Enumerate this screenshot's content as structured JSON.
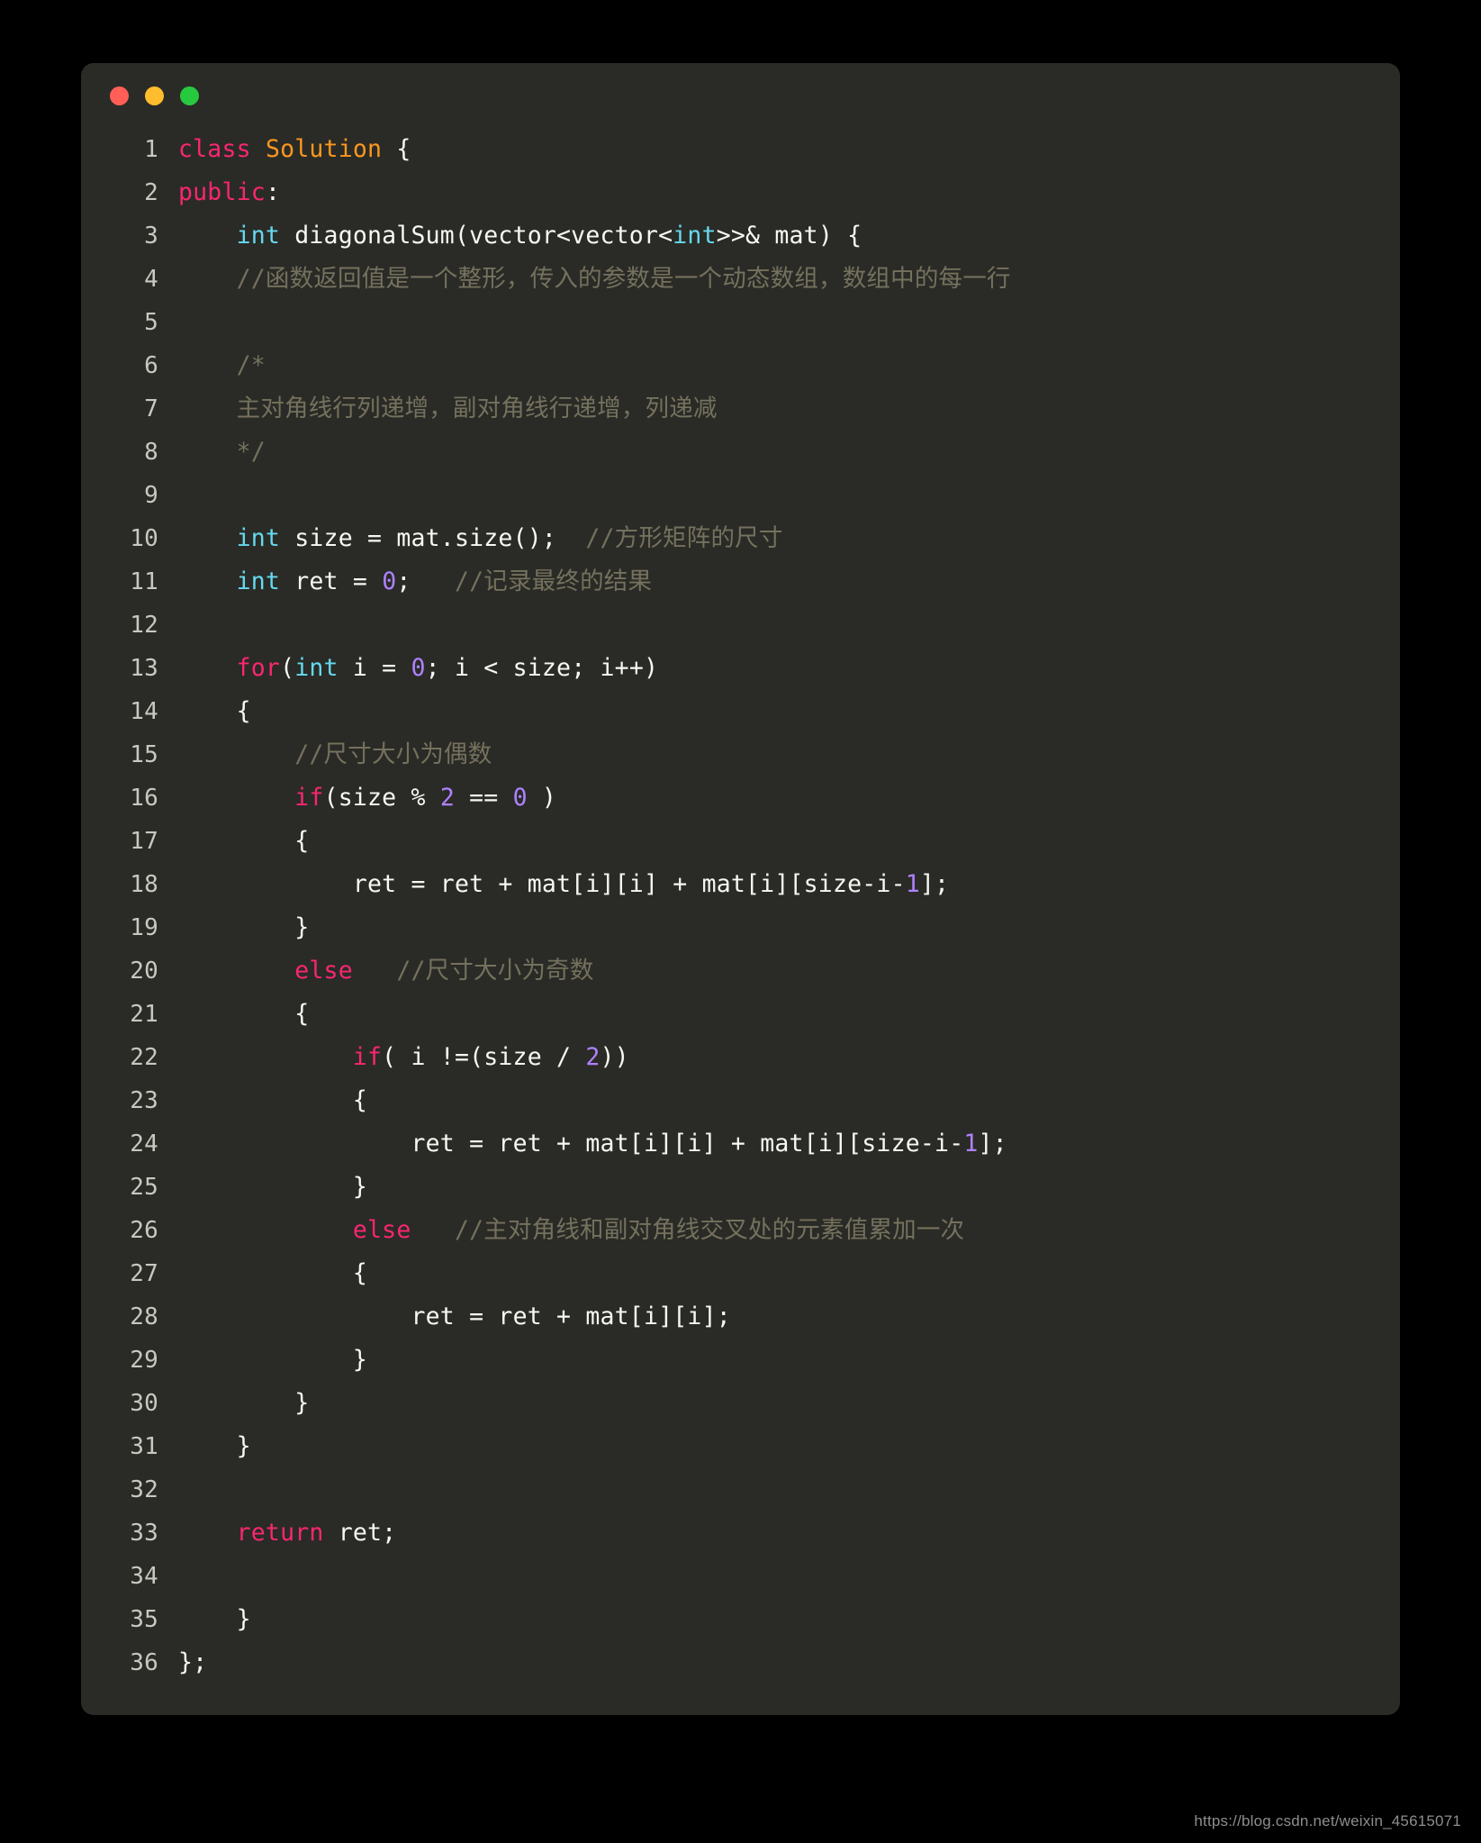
{
  "window": {
    "controls": [
      {
        "name": "close",
        "color": "#ff5f56"
      },
      {
        "name": "minimize",
        "color": "#ffbd2e"
      },
      {
        "name": "maximize",
        "color": "#27c93f"
      }
    ]
  },
  "theme": {
    "background": "#000000",
    "window_background": "#2a2b26",
    "keyword": "#f92672",
    "type": "#66d9ef",
    "class_name": "#fd971f",
    "number": "#ae81ff",
    "comment": "#75715e",
    "plain": "#f8f8f2",
    "line_number": "#c8c8c0"
  },
  "language": "C++",
  "code": {
    "lines": [
      {
        "n": "1",
        "tokens": [
          {
            "t": "class",
            "c": "kw"
          },
          {
            "t": " ",
            "c": "pun"
          },
          {
            "t": "Solution",
            "c": "cls"
          },
          {
            "t": " {",
            "c": "pun"
          }
        ]
      },
      {
        "n": "2",
        "tokens": [
          {
            "t": "public",
            "c": "kw"
          },
          {
            "t": ":",
            "c": "pun"
          }
        ]
      },
      {
        "n": "3",
        "tokens": [
          {
            "t": "    ",
            "c": "pun"
          },
          {
            "t": "int",
            "c": "typ"
          },
          {
            "t": " diagonalSum(vector<vector<",
            "c": "pun"
          },
          {
            "t": "int",
            "c": "typ"
          },
          {
            "t": ">>& mat) {",
            "c": "pun"
          }
        ]
      },
      {
        "n": "4",
        "tokens": [
          {
            "t": "    //函数返回值是一个整形，传入的参数是一个动态数组，数组中的每一行",
            "c": "cmt"
          }
        ]
      },
      {
        "n": "5",
        "tokens": [
          {
            "t": "",
            "c": "pun"
          }
        ]
      },
      {
        "n": "6",
        "tokens": [
          {
            "t": "    /*",
            "c": "cmt"
          }
        ]
      },
      {
        "n": "7",
        "tokens": [
          {
            "t": "    主对角线行列递增，副对角线行递增，列递减",
            "c": "cmt"
          }
        ]
      },
      {
        "n": "8",
        "tokens": [
          {
            "t": "    */",
            "c": "cmt"
          }
        ]
      },
      {
        "n": "9",
        "tokens": [
          {
            "t": "",
            "c": "pun"
          }
        ]
      },
      {
        "n": "10",
        "tokens": [
          {
            "t": "    ",
            "c": "pun"
          },
          {
            "t": "int",
            "c": "typ"
          },
          {
            "t": " size = mat.size();  ",
            "c": "pun"
          },
          {
            "t": "//方形矩阵的尺寸",
            "c": "cmt"
          }
        ]
      },
      {
        "n": "11",
        "tokens": [
          {
            "t": "    ",
            "c": "pun"
          },
          {
            "t": "int",
            "c": "typ"
          },
          {
            "t": " ret = ",
            "c": "pun"
          },
          {
            "t": "0",
            "c": "num"
          },
          {
            "t": ";   ",
            "c": "pun"
          },
          {
            "t": "//记录最终的结果",
            "c": "cmt"
          }
        ]
      },
      {
        "n": "12",
        "tokens": [
          {
            "t": "",
            "c": "pun"
          }
        ]
      },
      {
        "n": "13",
        "tokens": [
          {
            "t": "    ",
            "c": "pun"
          },
          {
            "t": "for",
            "c": "kw"
          },
          {
            "t": "(",
            "c": "pun"
          },
          {
            "t": "int",
            "c": "typ"
          },
          {
            "t": " i = ",
            "c": "pun"
          },
          {
            "t": "0",
            "c": "num"
          },
          {
            "t": "; i < size; i++)",
            "c": "pun"
          }
        ]
      },
      {
        "n": "14",
        "tokens": [
          {
            "t": "    {",
            "c": "pun"
          }
        ]
      },
      {
        "n": "15",
        "tokens": [
          {
            "t": "        //尺寸大小为偶数",
            "c": "cmt"
          }
        ]
      },
      {
        "n": "16",
        "tokens": [
          {
            "t": "        ",
            "c": "pun"
          },
          {
            "t": "if",
            "c": "kw"
          },
          {
            "t": "(size % ",
            "c": "pun"
          },
          {
            "t": "2",
            "c": "num"
          },
          {
            "t": " == ",
            "c": "pun"
          },
          {
            "t": "0",
            "c": "num"
          },
          {
            "t": " )",
            "c": "pun"
          }
        ]
      },
      {
        "n": "17",
        "tokens": [
          {
            "t": "        {",
            "c": "pun"
          }
        ]
      },
      {
        "n": "18",
        "tokens": [
          {
            "t": "            ret = ret + mat[i][i] + mat[i][size-i-",
            "c": "pun"
          },
          {
            "t": "1",
            "c": "num"
          },
          {
            "t": "];",
            "c": "pun"
          }
        ]
      },
      {
        "n": "19",
        "tokens": [
          {
            "t": "        }",
            "c": "pun"
          }
        ]
      },
      {
        "n": "20",
        "tokens": [
          {
            "t": "        ",
            "c": "pun"
          },
          {
            "t": "else",
            "c": "kw"
          },
          {
            "t": "   ",
            "c": "pun"
          },
          {
            "t": "//尺寸大小为奇数",
            "c": "cmt"
          }
        ]
      },
      {
        "n": "21",
        "tokens": [
          {
            "t": "        {",
            "c": "pun"
          }
        ]
      },
      {
        "n": "22",
        "tokens": [
          {
            "t": "            ",
            "c": "pun"
          },
          {
            "t": "if",
            "c": "kw"
          },
          {
            "t": "( i !=(size / ",
            "c": "pun"
          },
          {
            "t": "2",
            "c": "num"
          },
          {
            "t": "))",
            "c": "pun"
          }
        ]
      },
      {
        "n": "23",
        "tokens": [
          {
            "t": "            {",
            "c": "pun"
          }
        ]
      },
      {
        "n": "24",
        "tokens": [
          {
            "t": "                ret = ret + mat[i][i] + mat[i][size-i-",
            "c": "pun"
          },
          {
            "t": "1",
            "c": "num"
          },
          {
            "t": "];",
            "c": "pun"
          }
        ]
      },
      {
        "n": "25",
        "tokens": [
          {
            "t": "            }",
            "c": "pun"
          }
        ]
      },
      {
        "n": "26",
        "tokens": [
          {
            "t": "            ",
            "c": "pun"
          },
          {
            "t": "else",
            "c": "kw"
          },
          {
            "t": "   ",
            "c": "pun"
          },
          {
            "t": "//主对角线和副对角线交叉处的元素值累加一次",
            "c": "cmt"
          }
        ]
      },
      {
        "n": "27",
        "tokens": [
          {
            "t": "            {",
            "c": "pun"
          }
        ]
      },
      {
        "n": "28",
        "tokens": [
          {
            "t": "                ret = ret + mat[i][i];",
            "c": "pun"
          }
        ]
      },
      {
        "n": "29",
        "tokens": [
          {
            "t": "            }",
            "c": "pun"
          }
        ]
      },
      {
        "n": "30",
        "tokens": [
          {
            "t": "        }",
            "c": "pun"
          }
        ]
      },
      {
        "n": "31",
        "tokens": [
          {
            "t": "    }",
            "c": "pun"
          }
        ]
      },
      {
        "n": "32",
        "tokens": [
          {
            "t": "",
            "c": "pun"
          }
        ]
      },
      {
        "n": "33",
        "tokens": [
          {
            "t": "    ",
            "c": "pun"
          },
          {
            "t": "return",
            "c": "kw"
          },
          {
            "t": " ret;",
            "c": "pun"
          }
        ]
      },
      {
        "n": "34",
        "tokens": [
          {
            "t": "",
            "c": "pun"
          }
        ]
      },
      {
        "n": "35",
        "tokens": [
          {
            "t": "    }",
            "c": "pun"
          }
        ]
      },
      {
        "n": "36",
        "tokens": [
          {
            "t": "};",
            "c": "pun"
          }
        ]
      }
    ]
  },
  "watermark": "https://blog.csdn.net/weixin_45615071"
}
